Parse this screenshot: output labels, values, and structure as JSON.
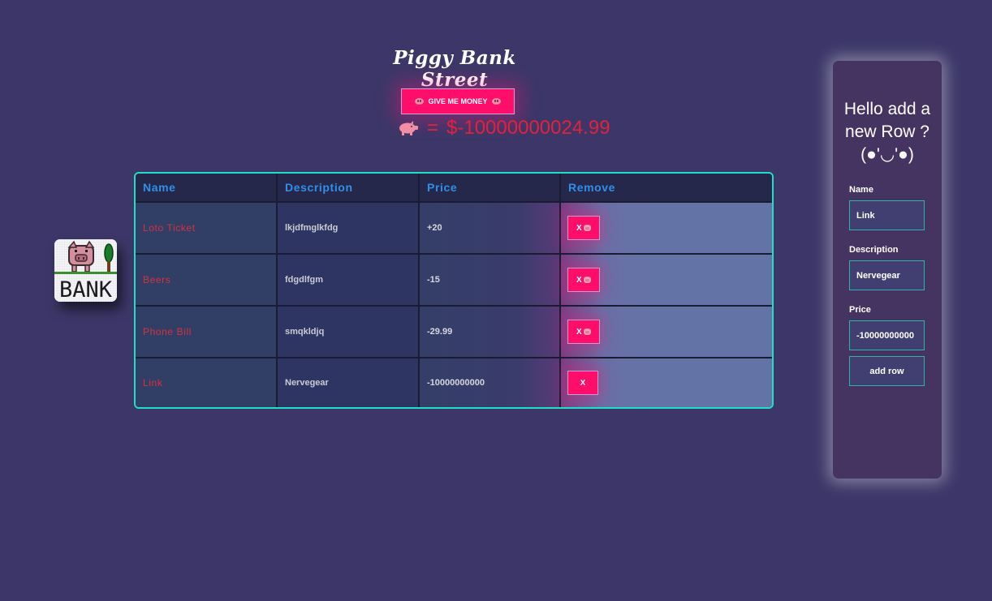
{
  "header": {
    "title": "Piggy Bank Street",
    "money_button_label": "GIVE ME MONEY",
    "total_equals": "=",
    "total_value": "$-10000000024.99"
  },
  "logo": {
    "text": "BANK"
  },
  "table": {
    "columns": [
      "Name",
      "Description",
      "Price",
      "Remove"
    ],
    "rows": [
      {
        "name": "Loto Ticket",
        "description": "lkjdfmglkfdg",
        "price": "+20",
        "remove_label": "X",
        "remove_icon": "pig-icon"
      },
      {
        "name": "Beers",
        "description": "fdgdlfgm",
        "price": "-15",
        "remove_label": "X",
        "remove_icon": "pig-icon"
      },
      {
        "name": "Phone Bill",
        "description": "smqkldjq",
        "price": "-29.99",
        "remove_label": "X",
        "remove_icon": "pig-icon"
      },
      {
        "name": "Link",
        "description": "Nervegear",
        "price": "-10000000000",
        "remove_label": "X",
        "remove_icon": ""
      }
    ]
  },
  "panel": {
    "heading": "Hello add a new Row ? (●'◡'●)",
    "name_label": "Name",
    "name_value": "Link",
    "description_label": "Description",
    "description_value": "Nervegear",
    "price_label": "Price",
    "price_value": "-10000000000",
    "add_button_label": "add row"
  },
  "colors": {
    "background": "#3c3768",
    "accent_pink": "#ff0d6a",
    "table_border": "#1ee0c6",
    "header_text": "#2f8fea",
    "name_text": "#d6313f",
    "total_text": "#e3213c"
  }
}
